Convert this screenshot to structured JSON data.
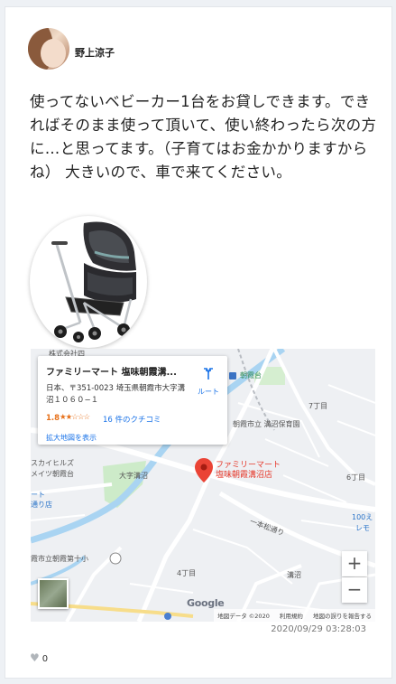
{
  "post": {
    "username": "野上涼子",
    "text": "使ってないベビーカー1台をお貸しできます。できればそのまま使って頂いて、使い終わったら次の方に…と思ってます。（子育てはお金かかりますからね） 大きいので、車で来てください。",
    "timestamp": "2020/09/29 03:28:03",
    "likes": "0"
  },
  "map": {
    "place_name": "ファミリーマート 塩味朝霞溝...",
    "address": "日本、〒351-0023 埼玉県朝霞市大字溝沼１０６０−１",
    "rating": "1.8",
    "stars": "★★☆☆☆",
    "reviews": "16 件のクチコミ",
    "route_label": "ルート",
    "enlarge_link": "拡大地図を表示",
    "pin_label_line1": "ファミリーマート",
    "pin_label_line2": "塩味朝霞溝沼店",
    "zoom_in": "+",
    "zoom_out": "−",
    "google": "Google",
    "attribution": {
      "data": "地図データ ©2020",
      "terms": "利用規約",
      "report": "地図の誤りを報告する"
    },
    "labels": {
      "company": "株式会社四",
      "asaka_tower": "朝霞台",
      "chome7": "7丁目",
      "hoikuen": "朝霞市立 溝沼保育園",
      "skyhills": "スカイヒルズ",
      "mates": "メイツ朝霞台",
      "mart": "ート",
      "mart2": "通り店",
      "osaka": "大字溝沼",
      "chome6": "6丁目",
      "ipponmatsu": "一本松通り",
      "e100": "100え",
      "lemo": "レモ",
      "school": "霞市立朝霞第十小",
      "chome4": "4丁目",
      "mizonuma": "溝沼"
    }
  }
}
